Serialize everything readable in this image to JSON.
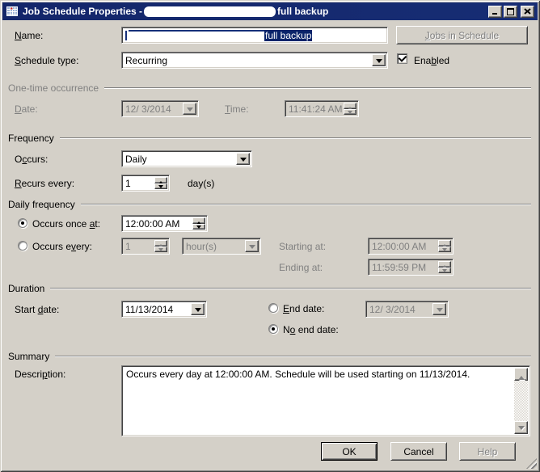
{
  "window": {
    "title_prefix": "Job Schedule Properties -",
    "title_suffix": "full backup"
  },
  "header": {
    "name_label": {
      "text": "Name:",
      "m": 0
    },
    "name_selected_text": "full backup",
    "jobs_button": {
      "text": "Jobs in Schedule",
      "m": 0
    },
    "schedule_type_label": {
      "text": "Schedule type:",
      "m": 0
    },
    "schedule_type_value": "Recurring",
    "enabled_label": {
      "text": "Enabled",
      "m": 3
    },
    "enabled_checked": true
  },
  "one_time": {
    "group_label": "One-time occurrence",
    "date_label": {
      "text": "Date:",
      "m": 0
    },
    "date_value": "12/ 3/2014",
    "time_label": {
      "text": "Time:",
      "m": 0
    },
    "time_value": "11:41:24 AM"
  },
  "frequency": {
    "group_label": "Frequency",
    "occurs_label": {
      "text": "Occurs:",
      "m": 1
    },
    "occurs_value": "Daily",
    "recurs_label": {
      "text": "Recurs every:",
      "m": 0
    },
    "recurs_value": "1",
    "recurs_unit": "day(s)"
  },
  "daily": {
    "group_label": "Daily frequency",
    "once_label": {
      "text": "Occurs once at:",
      "m": 12
    },
    "once_value": "12:00:00 AM",
    "once_selected": true,
    "every_label": {
      "text": "Occurs every:",
      "m": 8
    },
    "every_value": "1",
    "every_unit": "hour(s)",
    "starting_label": {
      "text": "Starting at:",
      "m": 7
    },
    "starting_value": "12:00:00 AM",
    "ending_label": {
      "text": "Ending at:",
      "m": 5
    },
    "ending_value": "11:59:59 PM"
  },
  "duration": {
    "group_label": "Duration",
    "start_label": {
      "text": "Start date:",
      "m": 6
    },
    "start_value": "11/13/2014",
    "end_label": {
      "text": "End date:",
      "m": 0
    },
    "end_value": "12/ 3/2014",
    "no_end_label": {
      "text": "No end date:",
      "m": 1
    },
    "no_end_selected": true
  },
  "summary": {
    "group_label": "Summary",
    "desc_label": {
      "text": "Description:",
      "m": 6
    },
    "description": "Occurs every day at 12:00:00 AM. Schedule will be used starting on 11/13/2014."
  },
  "footer": {
    "ok": "OK",
    "cancel": "Cancel",
    "help": "Help"
  },
  "colors": {
    "titlebar": "#13266a",
    "selection": "#0a246a",
    "dialog_face": "#d4d0c8",
    "disabled_text": "#808080"
  }
}
